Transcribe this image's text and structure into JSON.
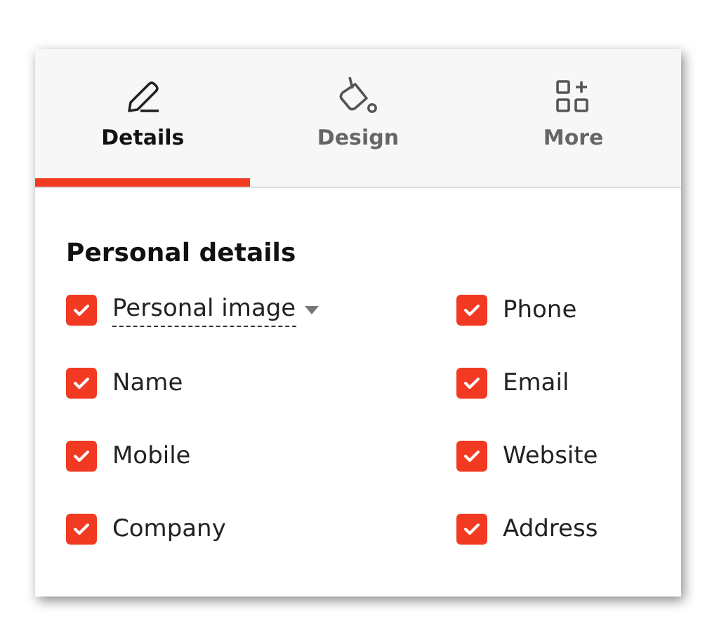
{
  "tabs": [
    {
      "label": "Details",
      "selected": true
    },
    {
      "label": "Design",
      "selected": false
    },
    {
      "label": "More",
      "selected": false
    }
  ],
  "section": {
    "title": "Personal details",
    "fields": [
      {
        "label": "Personal image",
        "checked": true,
        "kind": "dropdown"
      },
      {
        "label": "Phone",
        "checked": true,
        "kind": "plain"
      },
      {
        "label": "Name",
        "checked": true,
        "kind": "plain"
      },
      {
        "label": "Email",
        "checked": true,
        "kind": "plain"
      },
      {
        "label": "Mobile",
        "checked": true,
        "kind": "plain"
      },
      {
        "label": "Website",
        "checked": true,
        "kind": "plain"
      },
      {
        "label": "Company",
        "checked": true,
        "kind": "plain"
      },
      {
        "label": "Address",
        "checked": true,
        "kind": "plain"
      }
    ]
  }
}
